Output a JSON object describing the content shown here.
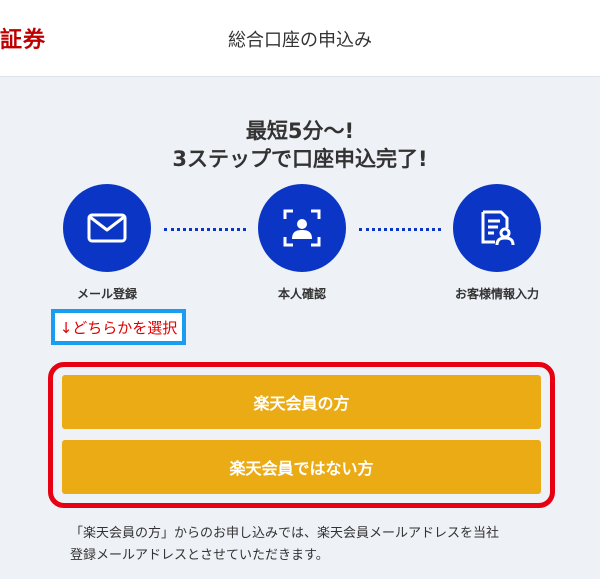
{
  "header": {
    "brand": "証券",
    "title": "総合口座の申込み"
  },
  "headline": {
    "line1": "最短5分〜!",
    "line2": "3ステップで口座申込完了!"
  },
  "steps": [
    {
      "label": "メール登録",
      "icon": "mail-icon"
    },
    {
      "label": "本人確認",
      "icon": "face-scan-icon"
    },
    {
      "label": "お客様情報入力",
      "icon": "document-user-icon"
    }
  ],
  "select_note": "↓どちらかを選択",
  "buttons": {
    "member": "楽天会員の方",
    "non_member": "楽天会員ではない方"
  },
  "footnote": {
    "line1": "「楽天会員の方」からのお申し込みでは、楽天会員メールアドレスを当社",
    "line2": "登録メールアドレスとさせていただきます。"
  },
  "colors": {
    "brand_red": "#bf0000",
    "step_blue": "#0b36c5",
    "button_yellow": "#ebab15",
    "highlight_red": "#e60012",
    "highlight_blue": "#1a9cf0"
  }
}
